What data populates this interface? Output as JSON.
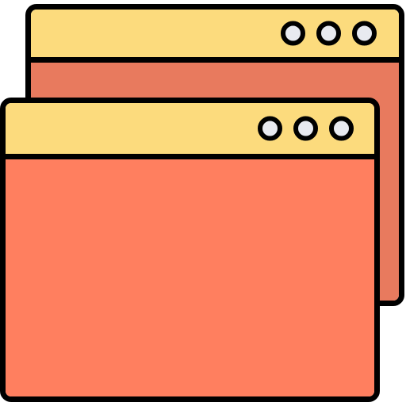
{
  "icon": {
    "name": "browser-windows-icon",
    "colors": {
      "titlebar": "#FCDB7D",
      "back_window_body": "#E87A5E",
      "front_window_body": "#FF7F5F",
      "dot_fill": "#E8EAF0",
      "outline": "#000000"
    }
  }
}
